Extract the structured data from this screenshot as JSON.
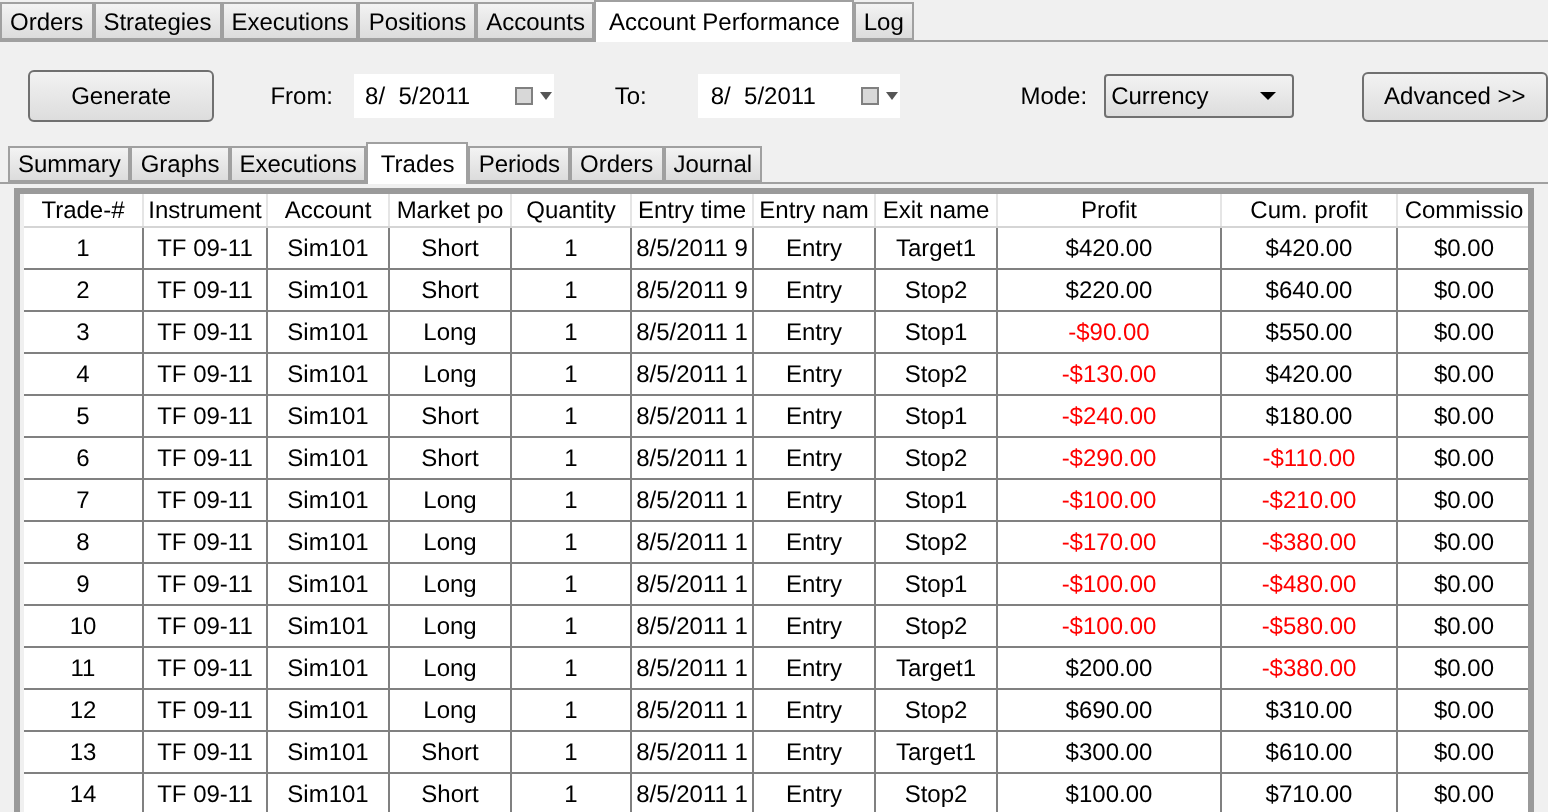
{
  "main_tabs": [
    {
      "label": "Orders",
      "selected": false
    },
    {
      "label": "Strategies",
      "selected": false
    },
    {
      "label": "Executions",
      "selected": false
    },
    {
      "label": "Positions",
      "selected": false
    },
    {
      "label": "Accounts",
      "selected": false
    },
    {
      "label": "Account Performance",
      "selected": true
    },
    {
      "label": "Log",
      "selected": false
    }
  ],
  "toolbar": {
    "generate_button": "Generate",
    "from_label": "From:",
    "from_value": "8/  5/2011",
    "to_label": "To:",
    "to_value": "8/  5/2011",
    "mode_label": "Mode:",
    "mode_value": "Currency",
    "advanced_button": "Advanced >>"
  },
  "sub_tabs": [
    {
      "label": "Summary",
      "selected": false
    },
    {
      "label": "Graphs",
      "selected": false
    },
    {
      "label": "Executions",
      "selected": false
    },
    {
      "label": "Trades",
      "selected": true
    },
    {
      "label": "Periods",
      "selected": false
    },
    {
      "label": "Orders",
      "selected": false
    },
    {
      "label": "Journal",
      "selected": false
    }
  ],
  "table": {
    "columns": [
      "Trade-#",
      "Instrument",
      "Account",
      "Market po",
      "Quantity",
      "Entry time",
      "Entry nam",
      "Exit name",
      "Profit",
      "Cum. profit",
      "Commissio"
    ],
    "rows": [
      {
        "cells": [
          "1",
          "TF 09-11",
          "Sim101",
          "Short",
          "1",
          "8/5/2011 9",
          "Entry",
          "Target1",
          "$420.00",
          "$420.00",
          "$0.00"
        ],
        "profit_negative": false,
        "cum_negative": false
      },
      {
        "cells": [
          "2",
          "TF 09-11",
          "Sim101",
          "Short",
          "1",
          "8/5/2011 9",
          "Entry",
          "Stop2",
          "$220.00",
          "$640.00",
          "$0.00"
        ],
        "profit_negative": false,
        "cum_negative": false
      },
      {
        "cells": [
          "3",
          "TF 09-11",
          "Sim101",
          "Long",
          "1",
          "8/5/2011 1",
          "Entry",
          "Stop1",
          "-$90.00",
          "$550.00",
          "$0.00"
        ],
        "profit_negative": true,
        "cum_negative": false
      },
      {
        "cells": [
          "4",
          "TF 09-11",
          "Sim101",
          "Long",
          "1",
          "8/5/2011 1",
          "Entry",
          "Stop2",
          "-$130.00",
          "$420.00",
          "$0.00"
        ],
        "profit_negative": true,
        "cum_negative": false
      },
      {
        "cells": [
          "5",
          "TF 09-11",
          "Sim101",
          "Short",
          "1",
          "8/5/2011 1",
          "Entry",
          "Stop1",
          "-$240.00",
          "$180.00",
          "$0.00"
        ],
        "profit_negative": true,
        "cum_negative": false
      },
      {
        "cells": [
          "6",
          "TF 09-11",
          "Sim101",
          "Short",
          "1",
          "8/5/2011 1",
          "Entry",
          "Stop2",
          "-$290.00",
          "-$110.00",
          "$0.00"
        ],
        "profit_negative": true,
        "cum_negative": true
      },
      {
        "cells": [
          "7",
          "TF 09-11",
          "Sim101",
          "Long",
          "1",
          "8/5/2011 1",
          "Entry",
          "Stop1",
          "-$100.00",
          "-$210.00",
          "$0.00"
        ],
        "profit_negative": true,
        "cum_negative": true
      },
      {
        "cells": [
          "8",
          "TF 09-11",
          "Sim101",
          "Long",
          "1",
          "8/5/2011 1",
          "Entry",
          "Stop2",
          "-$170.00",
          "-$380.00",
          "$0.00"
        ],
        "profit_negative": true,
        "cum_negative": true
      },
      {
        "cells": [
          "9",
          "TF 09-11",
          "Sim101",
          "Long",
          "1",
          "8/5/2011 1",
          "Entry",
          "Stop1",
          "-$100.00",
          "-$480.00",
          "$0.00"
        ],
        "profit_negative": true,
        "cum_negative": true
      },
      {
        "cells": [
          "10",
          "TF 09-11",
          "Sim101",
          "Long",
          "1",
          "8/5/2011 1",
          "Entry",
          "Stop2",
          "-$100.00",
          "-$580.00",
          "$0.00"
        ],
        "profit_negative": true,
        "cum_negative": true
      },
      {
        "cells": [
          "11",
          "TF 09-11",
          "Sim101",
          "Long",
          "1",
          "8/5/2011 1",
          "Entry",
          "Target1",
          "$200.00",
          "-$380.00",
          "$0.00"
        ],
        "profit_negative": false,
        "cum_negative": true
      },
      {
        "cells": [
          "12",
          "TF 09-11",
          "Sim101",
          "Long",
          "1",
          "8/5/2011 1",
          "Entry",
          "Stop2",
          "$690.00",
          "$310.00",
          "$0.00"
        ],
        "profit_negative": false,
        "cum_negative": false
      },
      {
        "cells": [
          "13",
          "TF 09-11",
          "Sim101",
          "Short",
          "1",
          "8/5/2011 1",
          "Entry",
          "Target1",
          "$300.00",
          "$610.00",
          "$0.00"
        ],
        "profit_negative": false,
        "cum_negative": false
      },
      {
        "cells": [
          "14",
          "TF 09-11",
          "Sim101",
          "Short",
          "1",
          "8/5/2011 1",
          "Entry",
          "Stop2",
          "$100.00",
          "$710.00",
          "$0.00"
        ],
        "profit_negative": false,
        "cum_negative": false
      }
    ]
  }
}
